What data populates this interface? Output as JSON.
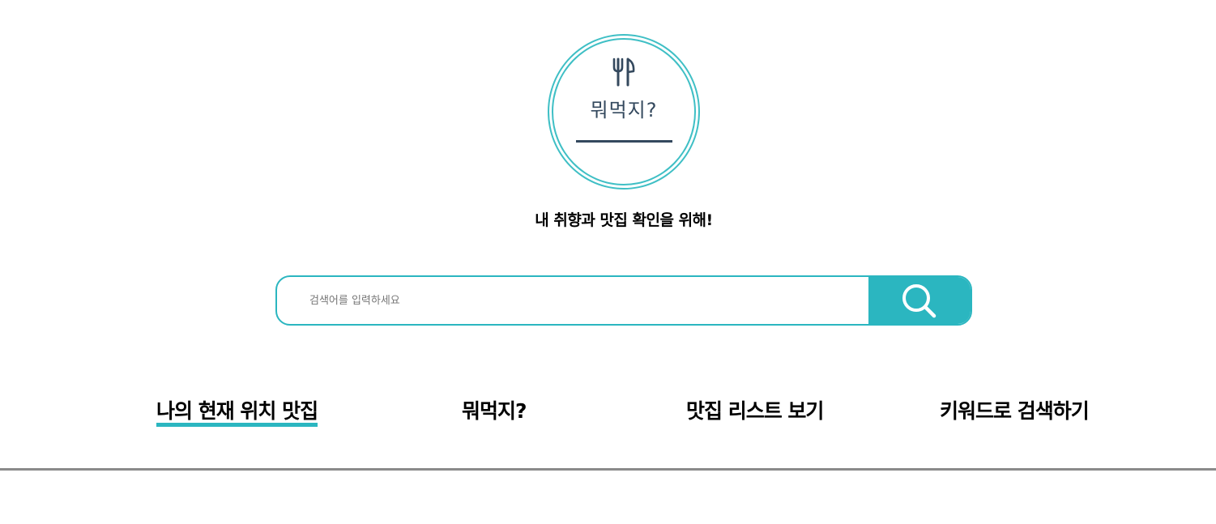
{
  "logo": {
    "title": "뭐먹지?",
    "icon": "fork-knife-icon",
    "ring_color": "#3fbfc5",
    "text_color": "#34495e"
  },
  "tagline": "내 취향과 맛집 확인을 위해!",
  "search": {
    "placeholder": "검색어를 입력하세요",
    "value": "",
    "button_icon": "search-icon",
    "accent_color": "#2bb6c0"
  },
  "nav": {
    "items": [
      {
        "label": "나의 현재 위치 맛집",
        "active": true
      },
      {
        "label": "뭐먹지?",
        "active": false
      },
      {
        "label": "맛집 리스트 보기",
        "active": false
      },
      {
        "label": "키워드로 검색하기",
        "active": false
      }
    ]
  }
}
